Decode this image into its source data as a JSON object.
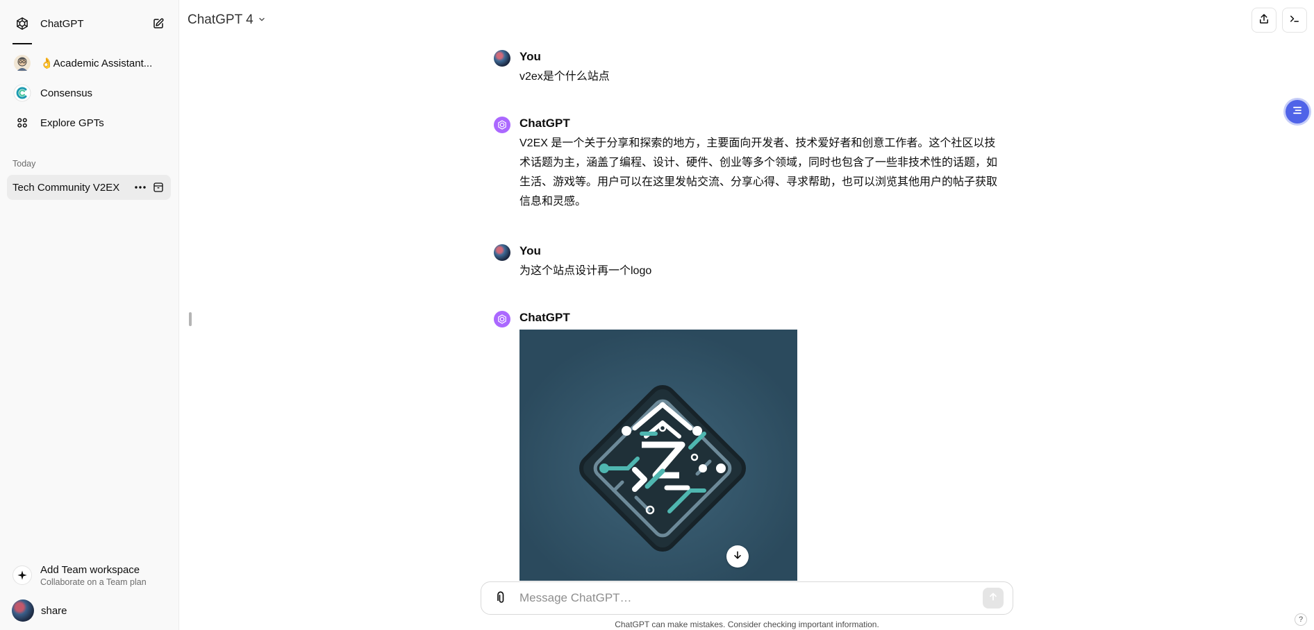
{
  "sidebar": {
    "new_chat": {
      "label": "ChatGPT",
      "icon": "openai-logo-icon",
      "action_icon": "new-chat-edit-icon"
    },
    "gpts": [
      {
        "label": "👌Academic Assistant...",
        "icon": "academic-assistant-avatar"
      },
      {
        "label": "Consensus",
        "icon": "consensus-logo-icon"
      },
      {
        "label": "Explore GPTs",
        "icon": "grid-icon"
      }
    ],
    "section_today": "Today",
    "active_chat": {
      "label": "Tech Community V2EX",
      "more_icon": "ellipsis-icon",
      "archive_icon": "archive-icon"
    },
    "team": {
      "title": "Add Team workspace",
      "subtitle": "Collaborate on a Team plan",
      "icon": "sparkle-icon"
    },
    "user": {
      "name": "share"
    }
  },
  "header": {
    "model": "ChatGPT 4",
    "share_icon": "share-upload-icon",
    "terminal_icon": "terminal-icon"
  },
  "messages": [
    {
      "author": "You",
      "text": "v2ex是个什么站点"
    },
    {
      "author": "ChatGPT",
      "text": "V2EX 是一个关于分享和探索的地方，主要面向开发者、技术爱好者和创意工作者。这个社区以技术话题为主，涵盖了编程、设计、硬件、创业等多个领域，同时也包含了一些非技术性的话题，如生活、游戏等。用户可以在这里发帖交流、分享心得、寻求帮助，也可以浏览其他用户的帖子获取信息和灵感。"
    },
    {
      "author": "You",
      "text": "为这个站点设计再一个logo"
    },
    {
      "author": "ChatGPT",
      "text": "",
      "image": "generated-logo-image"
    }
  ],
  "composer": {
    "placeholder": "Message ChatGPT…",
    "value": "",
    "disclaimer": "ChatGPT can make mistakes. Consider checking important information."
  },
  "help": "?",
  "colors": {
    "sidebar_bg": "#f9f9f9",
    "active_item_bg": "#ececec",
    "gpt_avatar": "#ab68ff",
    "floating_button": "#4f63e8",
    "image_bg": "#2e4d60",
    "logo_teal": "#4fb6b0"
  }
}
